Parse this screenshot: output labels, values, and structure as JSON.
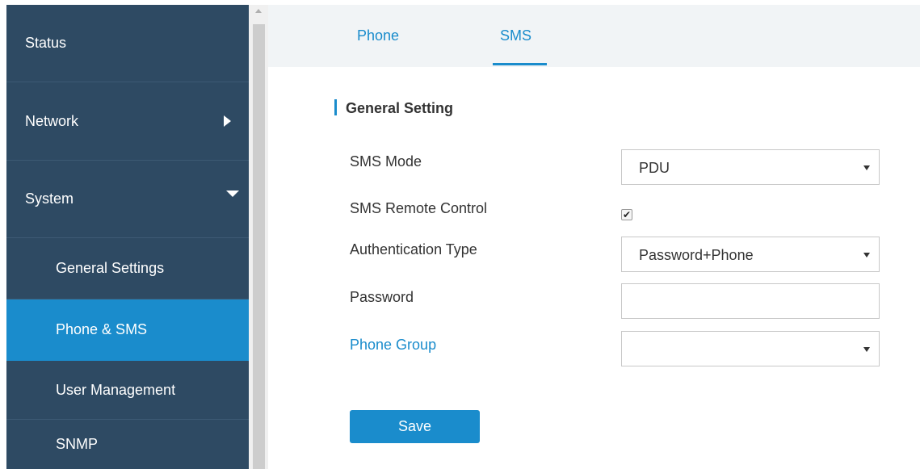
{
  "sidebar": {
    "items": [
      {
        "label": "Status"
      },
      {
        "label": "Network"
      },
      {
        "label": "System"
      },
      {
        "label": "General Settings"
      },
      {
        "label": "Phone & SMS"
      },
      {
        "label": "User Management"
      },
      {
        "label": "SNMP"
      }
    ],
    "active_color": "#1a8ccc",
    "background_color": "#2e4a63"
  },
  "tabs": [
    {
      "label": "Phone"
    },
    {
      "label": "SMS",
      "selected": true
    }
  ],
  "section": {
    "title": "General Setting"
  },
  "form": {
    "sms_mode": {
      "label": "SMS Mode",
      "value": "PDU"
    },
    "sms_remote_control": {
      "label": "SMS Remote Control",
      "checked": true,
      "check_glyph": "✔"
    },
    "auth_type": {
      "label": "Authentication Type",
      "value": "Password+Phone"
    },
    "password": {
      "label": "Password",
      "value": ""
    },
    "phone_group": {
      "label": "Phone Group",
      "value": ""
    }
  },
  "actions": {
    "save_label": "Save"
  },
  "icons": {
    "network_arrow": "chevron-right-icon",
    "system_arrow": "chevron-down-icon",
    "select_caret": "caret-down-icon",
    "checkbox_mark": "checkmark-icon"
  }
}
